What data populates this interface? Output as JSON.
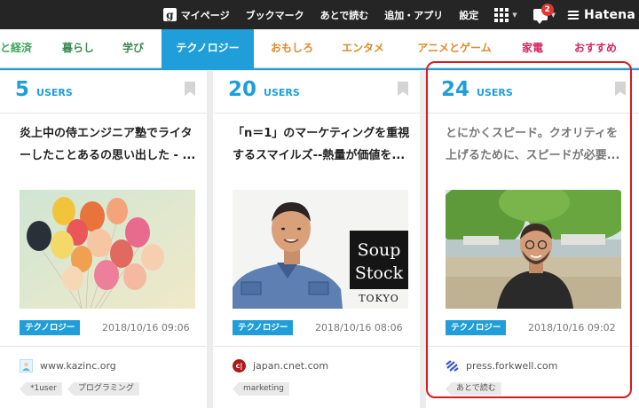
{
  "topbar": {
    "logo_glyph": "g",
    "mypage": "マイページ",
    "bookmark": "ブックマーク",
    "read_later": "あとで読む",
    "add_apps": "追加・アプリ",
    "settings": "設定",
    "notification_count": "2",
    "brand": "Hatena"
  },
  "categories": [
    {
      "label": "と経済",
      "color": "#3fa35b"
    },
    {
      "label": "暮らし",
      "color": "#3b8a4f"
    },
    {
      "label": "学び",
      "color": "#3b8a4f"
    },
    {
      "label": "テクノロジー",
      "color": "#ffffff"
    },
    {
      "label": "おもしろ",
      "color": "#e08a2b"
    },
    {
      "label": "エンタメ",
      "color": "#e08a2b"
    },
    {
      "label": "アニメとゲーム",
      "color": "#e08a2b"
    },
    {
      "label": "家電",
      "color": "#d4285f"
    },
    {
      "label": "おすすめ",
      "color": "#d4285f"
    }
  ],
  "entries": [
    {
      "users": "5",
      "users_label": "USERS",
      "title": "炎上中の侍エンジニア塾でライターしたことあるの思い出した - ...",
      "category_tag": "テクノロジー",
      "date": "2018/10/16 09:06",
      "domain": "www.kazinc.org",
      "tags": [
        "*1user",
        "プログラミング"
      ]
    },
    {
      "users": "20",
      "users_label": "USERS",
      "title": "「n＝1」のマーケティングを重視するスマイルズ--熱量が価値を...",
      "category_tag": "テクノロジー",
      "date": "2018/10/16 08:06",
      "domain": "japan.cnet.com",
      "tags": [
        "marketing"
      ],
      "image_text": {
        "line1": "Soup",
        "line2": "Stock",
        "line3": "TOKYO"
      }
    },
    {
      "users": "24",
      "users_label": "USERS",
      "title": "とにかくスピード。クオリティを上げるために、スピードが必要...",
      "category_tag": "テクノロジー",
      "date": "2018/10/16 09:02",
      "domain": "press.forkwell.com",
      "tags": [
        "あとで読む"
      ]
    }
  ],
  "colors": {
    "accent": "#1f9ed9",
    "topbar": "#252525",
    "highlight": "#d9191f",
    "badge": "#e0382f"
  }
}
